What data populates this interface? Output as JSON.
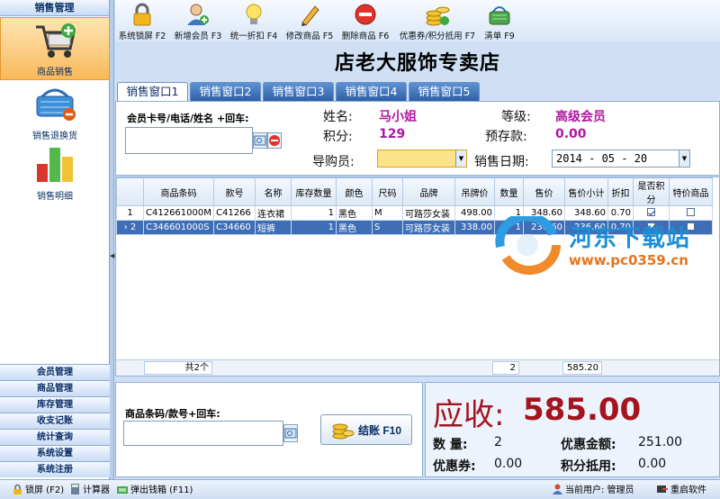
{
  "sidebar": {
    "header": "销售管理",
    "items": [
      {
        "label": "商品销售",
        "icon": "shopping-cart-add-icon"
      },
      {
        "label": "销售退换货",
        "icon": "basket-return-icon"
      },
      {
        "label": "销售明细",
        "icon": "bar-chart-icon"
      }
    ],
    "bottom": [
      "会员管理",
      "商品管理",
      "库存管理",
      "收支记账",
      "统计查询",
      "系统设置",
      "系统注册"
    ]
  },
  "toolbar": [
    {
      "label": "系统锁屏 F2",
      "icon": "lock-icon"
    },
    {
      "label": "新增会员 F3",
      "icon": "add-user-icon"
    },
    {
      "label": "统一折扣 F4",
      "icon": "bulb-icon"
    },
    {
      "label": "修改商品 F5",
      "icon": "pencil-icon"
    },
    {
      "label": "删除商品 F6",
      "icon": "delete-icon"
    },
    {
      "label": "优惠券/积分抵用 F7",
      "icon": "coins-icon"
    },
    {
      "label": "清单 F9",
      "icon": "basket-list-icon"
    }
  ],
  "title": "店老大服饰专卖店",
  "tabs": [
    "销售窗口1",
    "销售窗口2",
    "销售窗口3",
    "销售窗口4",
    "销售窗口5"
  ],
  "member": {
    "card_label": "会员卡号/电话/姓名 +回车:",
    "card_value": "",
    "name_label": "姓名:",
    "name": "马小姐",
    "level_label": "等级:",
    "level": "高级会员",
    "points_label": "积分:",
    "points": "129",
    "deposit_label": "预存款:",
    "deposit": "0.00",
    "guide_label": "导购员:",
    "guide_value": "",
    "date_label": "销售日期:",
    "date": "2014 - 05 - 20"
  },
  "grid": {
    "columns": [
      "",
      "商品条码",
      "款号",
      "名称",
      "库存数量",
      "颜色",
      "尺码",
      "品牌",
      "吊牌价",
      "数量",
      "售价",
      "售价小计",
      "折扣",
      "是否积分",
      "特价商品"
    ],
    "rows": [
      {
        "no": "1",
        "barcode": "C412661000M",
        "style": "C41266",
        "name": "连衣裙",
        "stock": "1",
        "color": "黑色",
        "size": "M",
        "brand": "可路莎女装",
        "tag_price": "498.00",
        "qty": "1",
        "price": "348.60",
        "subtotal": "348.60",
        "discount": "0.70",
        "points": true,
        "special": false
      },
      {
        "no": "2",
        "barcode": "C346601000S",
        "style": "C34660",
        "name": "短裤",
        "stock": "1",
        "color": "黑色",
        "size": "S",
        "brand": "可路莎女装",
        "tag_price": "338.00",
        "qty": "1",
        "price": "236.60",
        "subtotal": "236.60",
        "discount": "0.70",
        "points": true,
        "special": false
      }
    ],
    "footer": {
      "count": "共2个",
      "qty_total": "2",
      "amount_total": "585.20"
    }
  },
  "barcode": {
    "label": "商品条码/款号+回车:",
    "value": "",
    "settle_label": "结账 F10"
  },
  "summary": {
    "due_label": "应收:",
    "due": "585.00",
    "qty_label": "数  量:",
    "qty": "2",
    "discount_label": "优惠金额:",
    "discount": "251.00",
    "coupon_label": "优惠券:",
    "coupon": "0.00",
    "points_label": "积分抵用:",
    "points": "0.00"
  },
  "watermark": {
    "name": "河东下载站",
    "url": "www.pc0359.cn"
  },
  "statusbar": {
    "lock": "锁屏 (F2)",
    "calc": "计算器",
    "cashbox": "弹出钱箱 (F11)",
    "user": "当前用户: 管理员",
    "restart": "重启软件"
  }
}
